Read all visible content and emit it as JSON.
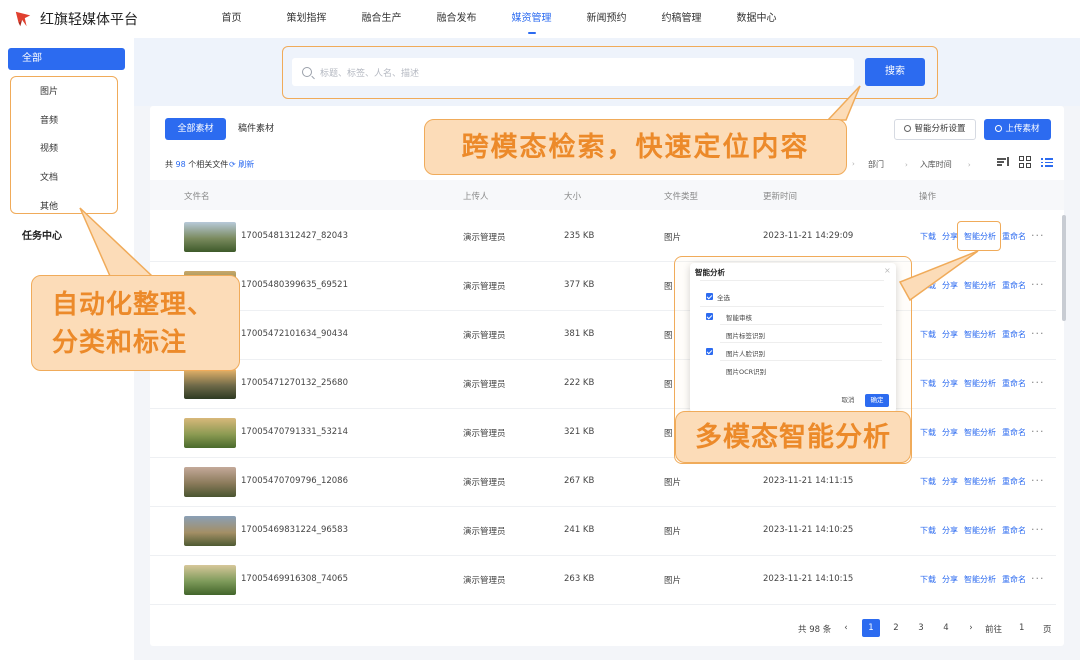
{
  "brand": {
    "name": "红旗轻媒体平台",
    "logo_color": "#e0402f"
  },
  "nav": {
    "items": [
      "首页",
      "策划指挥",
      "融合生产",
      "融合发布",
      "媒资管理",
      "新闻预约",
      "约稿管理",
      "数据中心"
    ],
    "active_index": 4
  },
  "sidebar": {
    "all_label": "全部",
    "types": [
      "图片",
      "音频",
      "视频",
      "文档",
      "其他"
    ],
    "task_center": "任务中心"
  },
  "search": {
    "placeholder": "标题、标签、人名、描述",
    "button_label": "搜索"
  },
  "tabs": {
    "all": "全部素材",
    "manuscript": "稿件素材"
  },
  "toolbar": {
    "analysis_settings": "智能分析设置",
    "upload": "上传素材"
  },
  "summary": {
    "prefix": "共",
    "count": "98",
    "suffix": "个相关文件",
    "refresh": "刷新"
  },
  "filters": {
    "department": "部门",
    "storage_time": "入库时间"
  },
  "table": {
    "headers": [
      "文件名",
      "上传人",
      "大小",
      "文件类型",
      "更新时间",
      "操作"
    ],
    "actions": [
      "下载",
      "分享",
      "智能分析",
      "重命名"
    ],
    "more": "···",
    "rows": [
      {
        "name": "17005481312427_82043",
        "uploader": "演示管理员",
        "size": "235 KB",
        "type": "图片",
        "time": "2023-11-21 14:29:09"
      },
      {
        "name": "17005480399635_69521",
        "uploader": "演示管理员",
        "size": "377 KB",
        "type": "图",
        "time": ""
      },
      {
        "name": "17005472101634_90434",
        "uploader": "演示管理员",
        "size": "381 KB",
        "type": "图",
        "time": ""
      },
      {
        "name": "17005471270132_25680",
        "uploader": "演示管理员",
        "size": "222 KB",
        "type": "图",
        "time": ""
      },
      {
        "name": "17005470791331_53214",
        "uploader": "演示管理员",
        "size": "321 KB",
        "type": "图",
        "time": ""
      },
      {
        "name": "17005470709796_12086",
        "uploader": "演示管理员",
        "size": "267 KB",
        "type": "图片",
        "time": "2023-11-21 14:11:15"
      },
      {
        "name": "17005469831224_96583",
        "uploader": "演示管理员",
        "size": "241 KB",
        "type": "图片",
        "time": "2023-11-21 14:10:25"
      },
      {
        "name": "17005469916308_74065",
        "uploader": "演示管理员",
        "size": "263 KB",
        "type": "图片",
        "time": "2023-11-21 14:10:15"
      }
    ]
  },
  "pagination": {
    "total": "共 98 条",
    "pages": [
      "1",
      "2",
      "3",
      "4"
    ],
    "active_page": "1",
    "goto_label": "前往",
    "goto_value": "1",
    "page_suffix": "页"
  },
  "popup": {
    "title": "智能分析",
    "close": "×",
    "select_all": "全选",
    "items": [
      "智能审核",
      "图片标签识别",
      "图片人脸识别",
      "图片OCR识别"
    ],
    "cancel": "取消",
    "confirm": "确定"
  },
  "callouts": {
    "search": "跨模态检索，快速定位内容",
    "auto_line1": "自动化整理、",
    "auto_line2": "分类和标注",
    "multi": "多模态智能分析"
  },
  "colors": {
    "accent": "#2c6bf0",
    "callout_fill": "#fcdcb8",
    "callout_text": "#ec8a2a",
    "callout_border": "#f0ab5a"
  }
}
